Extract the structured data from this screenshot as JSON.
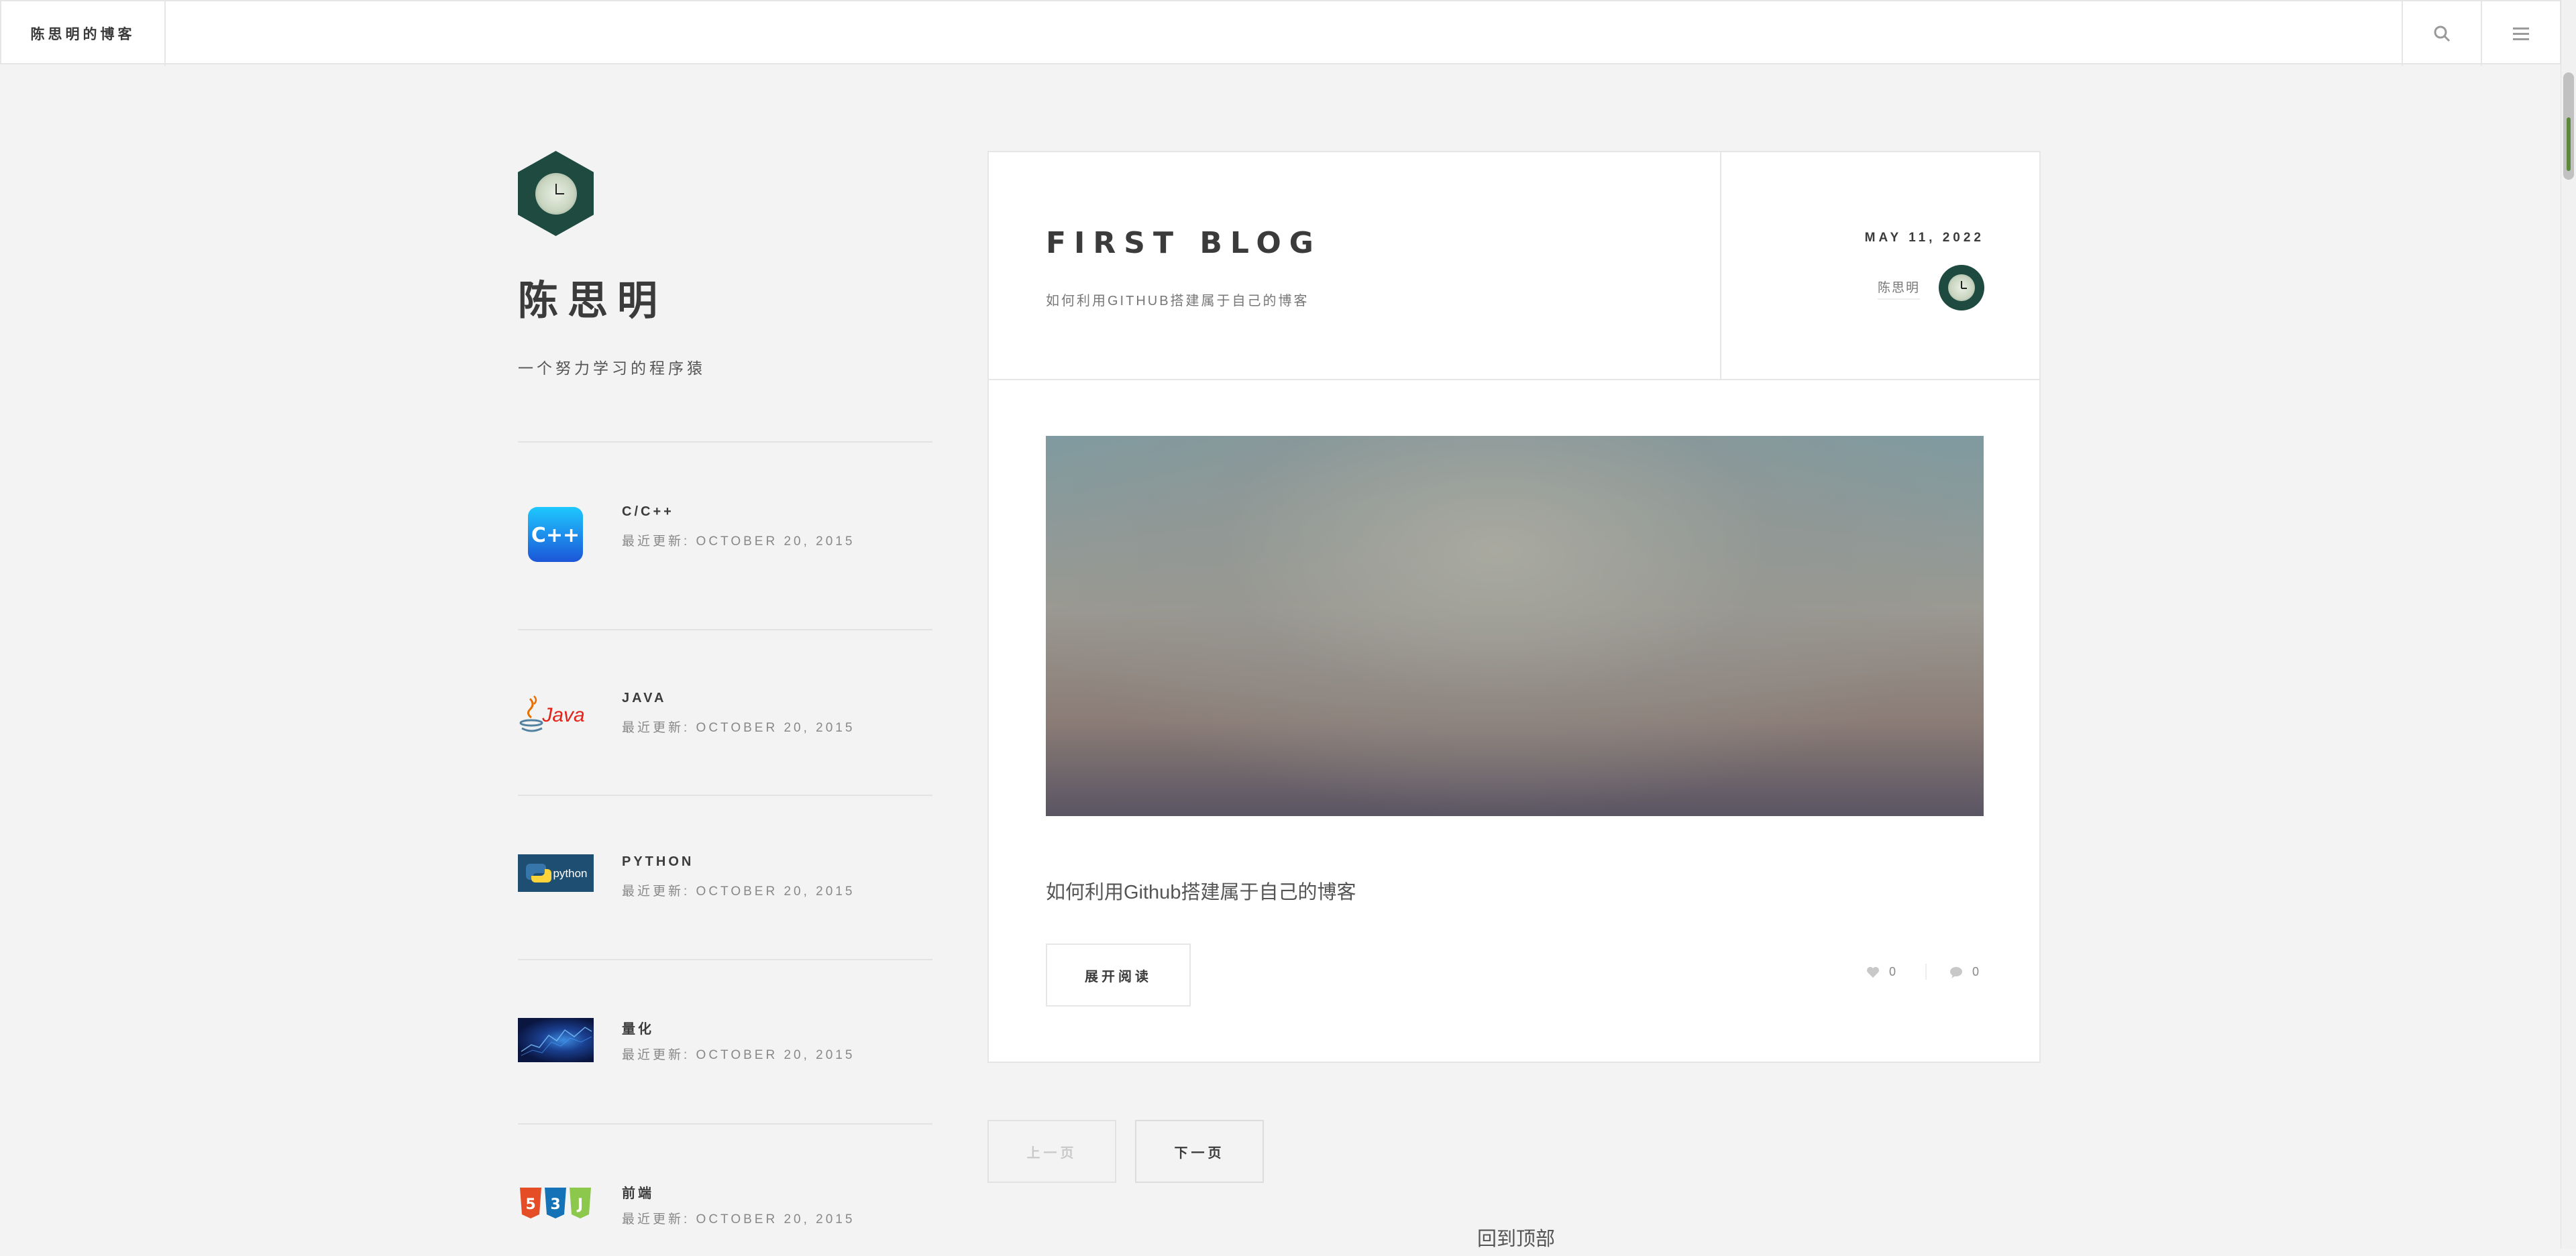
{
  "header": {
    "brand": "陈思明的博客",
    "search_icon": "search-icon",
    "menu_icon": "menu-icon"
  },
  "sidebar": {
    "author_name": "陈思明",
    "bio": "一个努力学习的程序猿",
    "items": [
      {
        "title": "C/C++",
        "meta": "最近更新: OCTOBER 20, 2015",
        "icon": "cpp-logo"
      },
      {
        "title": "JAVA",
        "meta": "最近更新: OCTOBER 20, 2015",
        "icon": "java-logo",
        "logo_text": "Java"
      },
      {
        "title": "PYTHON",
        "meta": "最近更新: OCTOBER 20, 2015",
        "icon": "python-logo",
        "logo_text": "python"
      },
      {
        "title": "量化",
        "meta": "最近更新: OCTOBER 20, 2015",
        "icon": "quant-image"
      },
      {
        "title": "前端",
        "meta": "最近更新: OCTOBER 20, 2015",
        "icon": "html-css-js-logo"
      }
    ]
  },
  "post": {
    "title": "FIRST BLOG",
    "subtitle": "如何利用GITHUB搭建属于自己的博客",
    "date": "MAY 11, 2022",
    "author": "陈思明",
    "excerpt": "如何利用Github搭建属于自己的博客",
    "read_more": "展开阅读",
    "likes": "0",
    "comments": "0"
  },
  "pagination": {
    "prev": "上一页",
    "next": "下一页"
  },
  "back_to_top": "回到顶部",
  "colors": {
    "background": "#f3f3f3",
    "card": "#ffffff",
    "text": "#3c3b3b",
    "border": "#e6e6e6"
  }
}
